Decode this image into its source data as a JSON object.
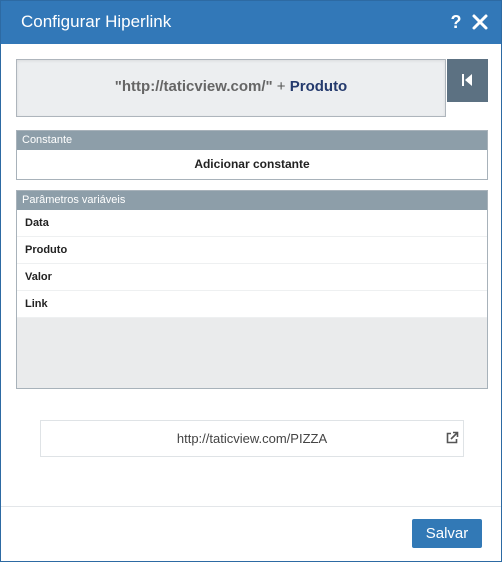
{
  "dialog": {
    "title": "Configurar Hiperlink",
    "help_label": "?"
  },
  "expression": {
    "constant": "\"http://taticview.com/\"",
    "operator": " + ",
    "variable": "Produto"
  },
  "constant_panel": {
    "header": "Constante",
    "add_label": "Adicionar constante"
  },
  "variables_panel": {
    "header": "Parâmetros variáveis",
    "items": [
      {
        "label": "Data"
      },
      {
        "label": "Produto"
      },
      {
        "label": "Valor"
      },
      {
        "label": "Link"
      }
    ]
  },
  "preview": {
    "url": "http://taticview.com/PIZZA"
  },
  "footer": {
    "save_label": "Salvar"
  },
  "colors": {
    "titlebar": "#3278b8",
    "panel_header": "#8d9ea9",
    "backspace_button": "#5c7182",
    "variable_text": "#243a6d",
    "save_button": "#3279b6"
  },
  "icons": {
    "close": "close-icon",
    "backspace": "backspace-icon",
    "external_link": "external-link-icon"
  }
}
